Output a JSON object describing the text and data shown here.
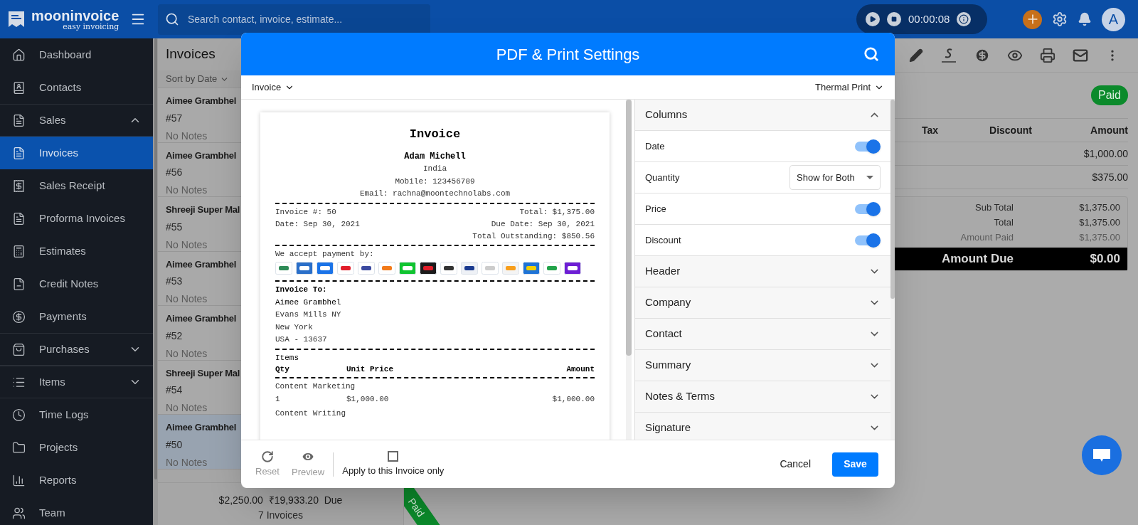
{
  "app": {
    "logo_name": "mooninvoice",
    "logo_tagline": "easy invoicing",
    "search_placeholder": "Search contact, invoice, estimate...",
    "timer": "00:00:08",
    "avatar": "A"
  },
  "sidebar": {
    "items": [
      {
        "label": "Dashboard",
        "kind": "link",
        "selected": false
      },
      {
        "label": "Contacts",
        "kind": "link",
        "selected": false
      },
      {
        "label": "Sales",
        "kind": "group",
        "expanded": true,
        "selected": false
      },
      {
        "label": "Invoices",
        "kind": "link",
        "selected": true
      },
      {
        "label": "Sales Receipt",
        "kind": "link",
        "selected": false
      },
      {
        "label": "Proforma Invoices",
        "kind": "link",
        "selected": false
      },
      {
        "label": "Estimates",
        "kind": "link",
        "selected": false
      },
      {
        "label": "Credit Notes",
        "kind": "link",
        "selected": false
      },
      {
        "label": "Payments",
        "kind": "link",
        "selected": false
      },
      {
        "label": "Purchases",
        "kind": "group",
        "expanded": false,
        "selected": false
      },
      {
        "label": "Items",
        "kind": "group",
        "expanded": false,
        "selected": false
      },
      {
        "label": "Time Logs",
        "kind": "link",
        "selected": false
      },
      {
        "label": "Projects",
        "kind": "link",
        "selected": false
      },
      {
        "label": "Reports",
        "kind": "link",
        "selected": false
      },
      {
        "label": "Team",
        "kind": "link",
        "selected": false
      }
    ]
  },
  "invoice_list": {
    "title": "Invoices",
    "sort": "Sort by Date",
    "items": [
      {
        "name": "Aimee Grambhel",
        "number": "#57",
        "notes": "No Notes",
        "selected": false
      },
      {
        "name": "Aimee Grambhel",
        "number": "#56",
        "notes": "No Notes",
        "selected": false
      },
      {
        "name": "Shreeji Super Mal",
        "number": "#55",
        "notes": "No Notes",
        "selected": false
      },
      {
        "name": "Aimee Grambhel",
        "number": "#53",
        "notes": "No Notes",
        "selected": false
      },
      {
        "name": "Aimee Grambhel",
        "number": "#52",
        "notes": "No Notes",
        "selected": false
      },
      {
        "name": "Shreeji Super Mal",
        "number": "#54",
        "notes": "No Notes",
        "selected": false
      },
      {
        "name": "Aimee Grambhel",
        "number": "#50",
        "notes": "No Notes",
        "selected": true
      }
    ],
    "footer": {
      "totals": "$2,250.00  ₹19,933.20  Due",
      "count": "7 Invoices"
    }
  },
  "invoice_detail": {
    "status": "Paid",
    "columns": [
      "Tax",
      "Discount",
      "Amount"
    ],
    "rows": [
      {
        "amount": "$1,000.00"
      },
      {
        "amount": "$375.00"
      }
    ],
    "summary": [
      {
        "label": "Sub Total",
        "value": "$1,375.00"
      },
      {
        "label": "Total",
        "value": "$1,375.00"
      },
      {
        "label": "Amount Paid",
        "value": "$1,375.00"
      }
    ],
    "amount_due": {
      "label": "Amount Due",
      "value": "$0.00"
    },
    "ribbon": "Paid"
  },
  "dialog": {
    "title": "PDF & Print Settings",
    "document_type": "Invoice",
    "print_format": "Thermal Print",
    "receipt": {
      "title": "Invoice",
      "company_name": "Adam Michell",
      "company_lines": [
        "India",
        "Mobile: 123456789",
        "Email: rachna@moontechnolabs.com"
      ],
      "meta": [
        {
          "left": "Invoice #: 50",
          "right": "Total: $1,375.00"
        },
        {
          "left": "Date: Sep 30, 2021",
          "right": "Due Date: Sep 30, 2021"
        },
        {
          "right": "Total Outstanding: $850.56"
        }
      ],
      "payment_label": "We accept payment by:",
      "bill_to_label": "Invoice To:",
      "bill_to_name": "Aimee Grambhel",
      "bill_to_lines": [
        "Evans Mills NY",
        "New York",
        "USA - 13637"
      ],
      "items_label": "Items",
      "item_columns": [
        "Qty",
        "Unit Price",
        "Amount"
      ],
      "items": [
        {
          "name": "Content Marketing",
          "qty": "1",
          "unit_price": "$1,000.00",
          "amount": "$1,000.00"
        },
        {
          "name": "Content Writing"
        }
      ]
    },
    "sections": [
      {
        "label": "Columns",
        "expanded": true,
        "rows": [
          {
            "kind": "toggle",
            "label": "Date",
            "on": true
          },
          {
            "kind": "select",
            "label": "Quantity",
            "value": "Show for Both"
          },
          {
            "kind": "toggle",
            "label": "Price",
            "on": true
          },
          {
            "kind": "toggle",
            "label": "Discount",
            "on": true
          }
        ]
      },
      {
        "label": "Header",
        "expanded": false
      },
      {
        "label": "Company",
        "expanded": false
      },
      {
        "label": "Contact",
        "expanded": false
      },
      {
        "label": "Summary",
        "expanded": false
      },
      {
        "label": "Notes & Terms",
        "expanded": false
      },
      {
        "label": "Signature",
        "expanded": false
      }
    ],
    "footer": {
      "reset": {
        "label": "Reset",
        "disabled": true
      },
      "preview": {
        "label": "Preview",
        "disabled": true
      },
      "apply_only": {
        "label": "Apply to this Invoice only",
        "checked": false
      },
      "cancel": "Cancel",
      "save": "Save"
    }
  }
}
